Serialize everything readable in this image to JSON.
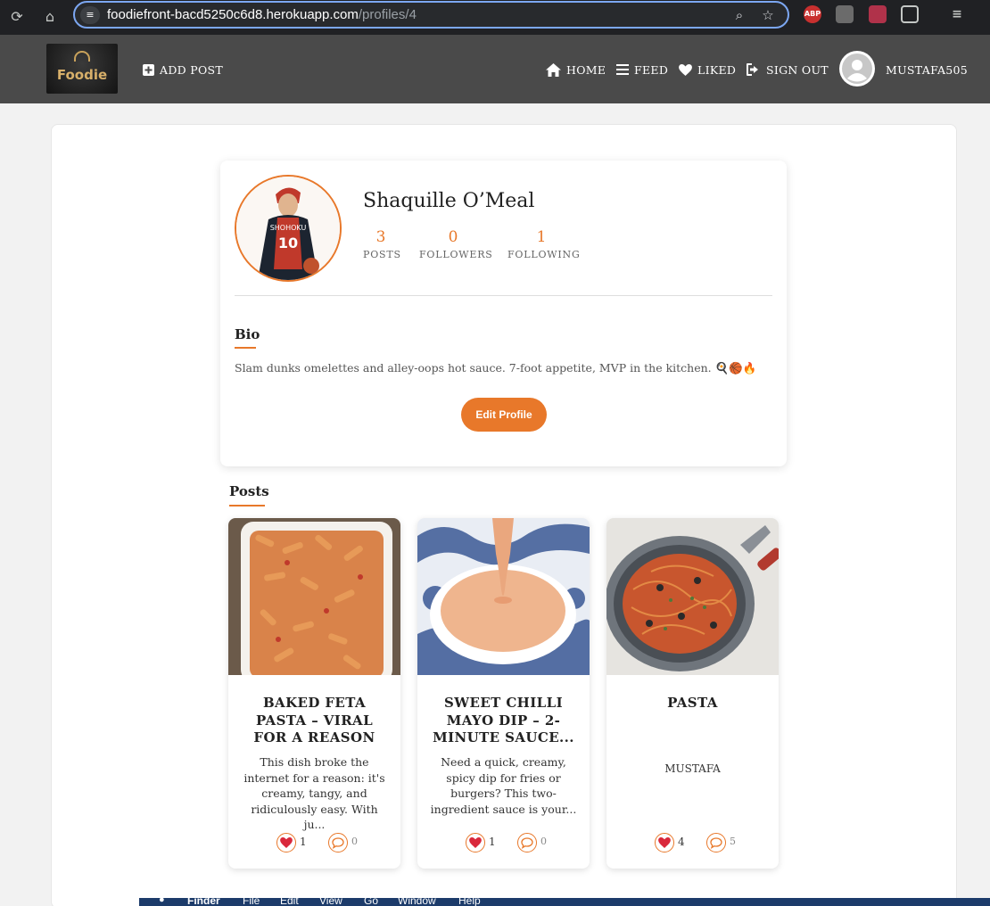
{
  "browser": {
    "url_host": "foodiefront-bacd5250c6d8.herokuapp.com",
    "url_path": "/profiles/4",
    "ext_abp": "ABP"
  },
  "navbar": {
    "logo_text": "Foodie",
    "add_post": "ADD POST",
    "home": "HOME",
    "feed": "FEED",
    "liked": "LIKED",
    "sign_out": "SIGN OUT",
    "username": "MUSTAFA505"
  },
  "profile": {
    "name": "Shaquille O’Meal",
    "posts_count": "3",
    "posts_label": "POSTS",
    "followers_count": "0",
    "followers_label": "FOLLOWERS",
    "following_count": "1",
    "following_label": "FOLLOWING",
    "bio_title": "Bio",
    "bio_text": "Slam dunks omelettes and alley-oops hot sauce. 7-foot appetite, MVP in the kitchen. 🍳🏀🔥",
    "jersey_text": "SHOHOKU",
    "jersey_number": "10",
    "edit_button": "Edit Profile"
  },
  "posts_section": {
    "title": "Posts"
  },
  "posts": [
    {
      "title": "BAKED FETA PASTA – VIRAL FOR A REASON",
      "description": "This dish broke the internet for a reason: it's creamy, tangy, and ridiculously easy. With ju...",
      "likes": "1",
      "comments": "0"
    },
    {
      "title": "SWEET CHILLI MAYO DIP – 2-MINUTE SAUCE...",
      "description": "Need a quick, creamy, spicy dip for fries or burgers? This two-ingredient sauce is your...",
      "likes": "1",
      "comments": "0"
    },
    {
      "title": "PASTA",
      "author": "MUSTAFA",
      "likes": "4",
      "comments": "5"
    }
  ],
  "os_menu": [
    "Finder",
    "File",
    "Edit",
    "View",
    "Go",
    "Window",
    "Help"
  ],
  "colors": {
    "accent": "#e8782a",
    "navbar": "#4a4a4a",
    "like_heart": "#d9283c"
  }
}
